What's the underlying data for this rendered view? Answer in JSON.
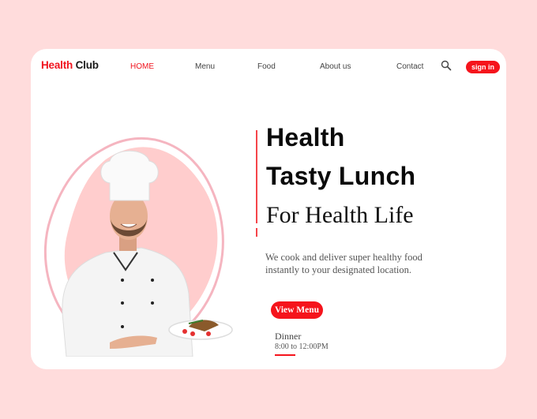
{
  "header": {
    "logo_part1": "Health",
    "logo_part2": "Club",
    "nav": [
      {
        "label": "HOME",
        "active": true
      },
      {
        "label": "Menu",
        "active": false
      },
      {
        "label": "Food",
        "active": false
      },
      {
        "label": "About us",
        "active": false
      },
      {
        "label": "Contact",
        "active": false
      }
    ],
    "search_icon": "search-icon",
    "signin_label": "sign in"
  },
  "hero": {
    "title_line1": "Health",
    "title_line2": "Tasty Lunch",
    "subtitle": "For Health Life",
    "description": "We cook and deliver super healthy food instantly to your designated location.",
    "cta_label": "View Menu",
    "schedule_label": "Dinner",
    "schedule_time": "8:00 to 12:00PM",
    "image_alt": "Smiling chef in white uniform holding a plate of food"
  },
  "colors": {
    "accent": "#f0141e",
    "background": "#ffdcdc",
    "blob": "#ffcdcd"
  }
}
